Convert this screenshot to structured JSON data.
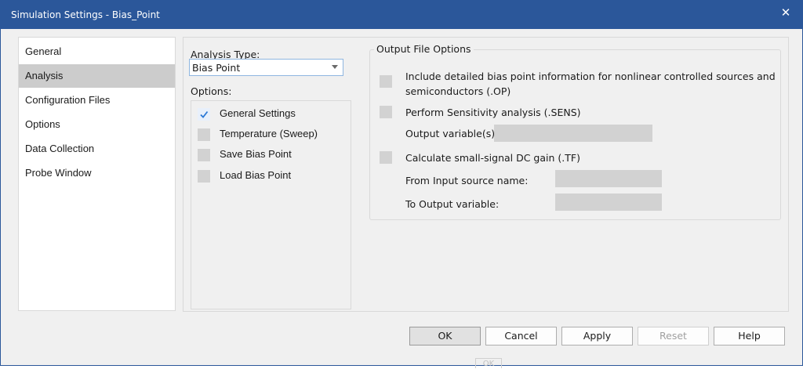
{
  "window": {
    "title": "Simulation Settings - Bias_Point",
    "close_glyph": "✕"
  },
  "sidebar": {
    "items": [
      {
        "label": "General"
      },
      {
        "label": "Analysis",
        "selected": true
      },
      {
        "label": "Configuration Files"
      },
      {
        "label": "Options"
      },
      {
        "label": "Data Collection"
      },
      {
        "label": "Probe Window"
      }
    ]
  },
  "analysis": {
    "type_label": "Analysis Type:",
    "type_value": "Bias Point",
    "options_label": "Options:",
    "options": [
      {
        "label": "General Settings",
        "checked": true
      },
      {
        "label": "Temperature (Sweep)",
        "checked": false
      },
      {
        "label": "Save Bias Point",
        "checked": false
      },
      {
        "label": "Load Bias Point",
        "checked": false
      }
    ]
  },
  "output": {
    "group_title": "Output File Options",
    "op_label_line1": "Include detailed bias point information for nonlinear controlled sources and",
    "op_label_line2": "semiconductors (.OP)",
    "sens_label": "Perform Sensitivity analysis (.SENS)",
    "output_vars_label": "Output variable(s):",
    "output_vars_value": "",
    "tf_label": "Calculate small-signal DC gain (.TF)",
    "from_input_label": "From Input source name:",
    "from_input_value": "",
    "to_output_label": "To Output variable:",
    "to_output_value": ""
  },
  "buttons": {
    "ok": "OK",
    "cancel": "Cancel",
    "apply": "Apply",
    "reset": "Reset",
    "help": "Help",
    "ghost_ok": "OK"
  },
  "colors": {
    "titlebar": "#2b579a",
    "selection": "#cccccc",
    "check_accent": "#2b79d6"
  }
}
